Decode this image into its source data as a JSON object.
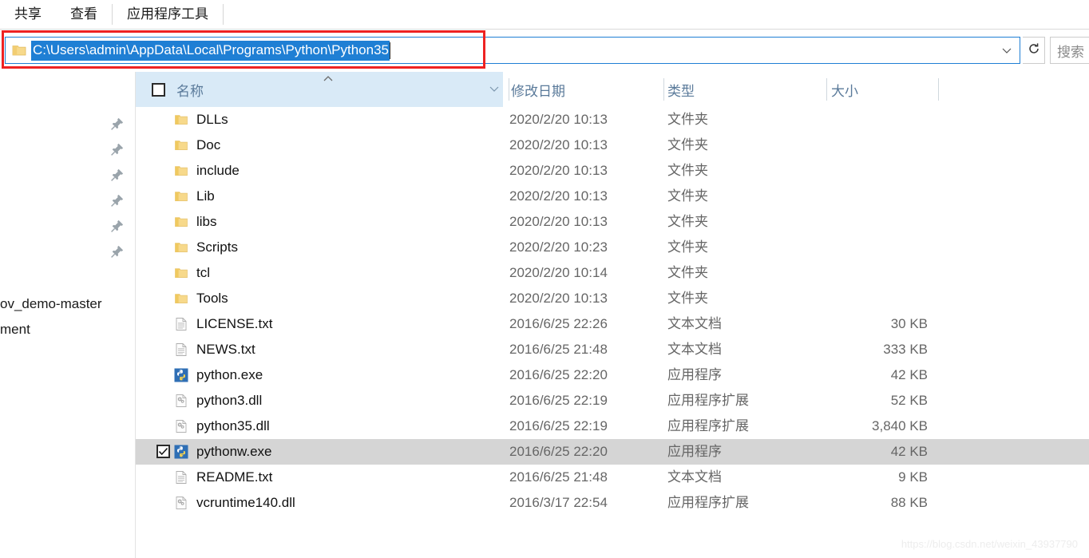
{
  "ribbon": {
    "tabs": [
      {
        "label": "共享"
      },
      {
        "label": "查看"
      },
      {
        "label": "应用程序工具"
      }
    ]
  },
  "address_bar": {
    "folder_icon": "folder-icon",
    "path_value": "C:\\Users\\admin\\AppData\\Local\\Programs\\Python\\Python35",
    "dropdown_icon": "chevron-down-icon",
    "refresh_icon": "refresh-icon",
    "selected": true,
    "annotation_color": "#ee2222",
    "border_color": "#1f7fd4",
    "selection_color": "#1f7fd4"
  },
  "search": {
    "placeholder": "搜索",
    "value": ""
  },
  "sidebar": {
    "pins": [
      {
        "icon": "pin-icon"
      },
      {
        "icon": "pin-icon"
      },
      {
        "icon": "pin-icon"
      },
      {
        "icon": "pin-icon"
      },
      {
        "icon": "pin-icon"
      },
      {
        "icon": "pin-icon"
      }
    ],
    "clipped_labels": [
      {
        "text": "ov_demo-master"
      },
      {
        "text": "ment"
      }
    ]
  },
  "file_list": {
    "columns": [
      {
        "key": "name",
        "label": "名称",
        "sort": "asc"
      },
      {
        "key": "date",
        "label": "修改日期"
      },
      {
        "key": "type",
        "label": "类型"
      },
      {
        "key": "size",
        "label": "大小"
      }
    ],
    "header_checkbox_checked": false,
    "sort_caret": "⌃",
    "name_chevron": "chevron-down-icon",
    "rows": [
      {
        "name": "DLLs",
        "date": "2020/2/20 10:13",
        "type": "文件夹",
        "size": "",
        "icon": "folder-icon",
        "selected": false
      },
      {
        "name": "Doc",
        "date": "2020/2/20 10:13",
        "type": "文件夹",
        "size": "",
        "icon": "folder-icon",
        "selected": false
      },
      {
        "name": "include",
        "date": "2020/2/20 10:13",
        "type": "文件夹",
        "size": "",
        "icon": "folder-icon",
        "selected": false
      },
      {
        "name": "Lib",
        "date": "2020/2/20 10:13",
        "type": "文件夹",
        "size": "",
        "icon": "folder-icon",
        "selected": false
      },
      {
        "name": "libs",
        "date": "2020/2/20 10:13",
        "type": "文件夹",
        "size": "",
        "icon": "folder-icon",
        "selected": false
      },
      {
        "name": "Scripts",
        "date": "2020/2/20 10:23",
        "type": "文件夹",
        "size": "",
        "icon": "folder-icon",
        "selected": false
      },
      {
        "name": "tcl",
        "date": "2020/2/20 10:14",
        "type": "文件夹",
        "size": "",
        "icon": "folder-icon",
        "selected": false
      },
      {
        "name": "Tools",
        "date": "2020/2/20 10:13",
        "type": "文件夹",
        "size": "",
        "icon": "folder-icon",
        "selected": false
      },
      {
        "name": "LICENSE.txt",
        "date": "2016/6/25 22:26",
        "type": "文本文档",
        "size": "30 KB",
        "icon": "text-file-icon",
        "selected": false
      },
      {
        "name": "NEWS.txt",
        "date": "2016/6/25 21:48",
        "type": "文本文档",
        "size": "333 KB",
        "icon": "text-file-icon",
        "selected": false
      },
      {
        "name": "python.exe",
        "date": "2016/6/25 22:20",
        "type": "应用程序",
        "size": "42 KB",
        "icon": "python-exe-icon",
        "selected": false
      },
      {
        "name": "python3.dll",
        "date": "2016/6/25 22:19",
        "type": "应用程序扩展",
        "size": "52 KB",
        "icon": "dll-file-icon",
        "selected": false
      },
      {
        "name": "python35.dll",
        "date": "2016/6/25 22:19",
        "type": "应用程序扩展",
        "size": "3,840 KB",
        "icon": "dll-file-icon",
        "selected": false
      },
      {
        "name": "pythonw.exe",
        "date": "2016/6/25 22:20",
        "type": "应用程序",
        "size": "42 KB",
        "icon": "python-exe-icon",
        "selected": true
      },
      {
        "name": "README.txt",
        "date": "2016/6/25 21:48",
        "type": "文本文档",
        "size": "9 KB",
        "icon": "text-file-icon",
        "selected": false
      },
      {
        "name": "vcruntime140.dll",
        "date": "2016/3/17 22:54",
        "type": "应用程序扩展",
        "size": "88 KB",
        "icon": "dll-file-icon",
        "selected": false
      }
    ]
  },
  "watermark": {
    "text": "https://blog.csdn.net/weixin_43937790"
  }
}
